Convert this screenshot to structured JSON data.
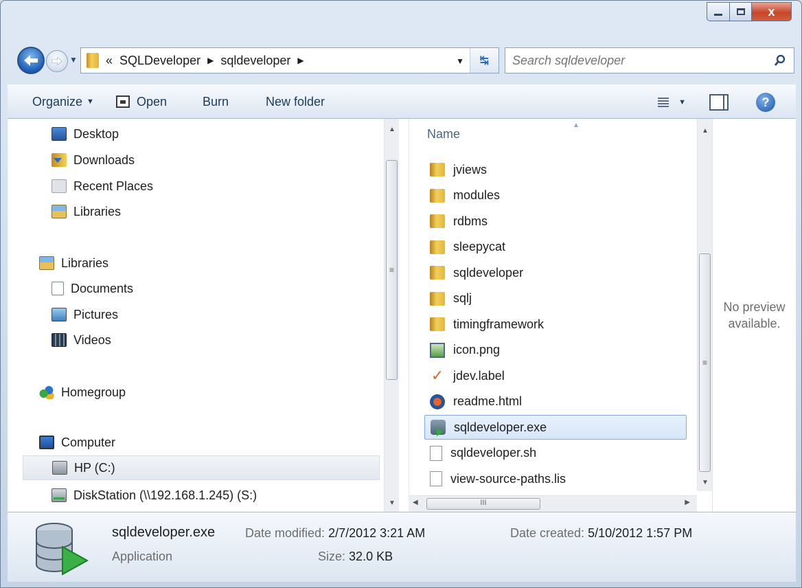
{
  "window": {
    "caption_buttons": {
      "minimize": "minimize",
      "maximize": "maximize",
      "close": "x"
    }
  },
  "address": {
    "overflow": "«",
    "crumbs": [
      "SQLDeveloper",
      "sqldeveloper"
    ],
    "search_placeholder": "Search sqldeveloper"
  },
  "toolbar": {
    "organize": "Organize",
    "open": "Open",
    "burn": "Burn",
    "new_folder": "New folder"
  },
  "nav": {
    "favorites": [
      "Desktop",
      "Downloads",
      "Recent Places",
      "Libraries"
    ],
    "libraries_root": "Libraries",
    "libraries": [
      "Documents",
      "Pictures",
      "Videos"
    ],
    "homegroup": "Homegroup",
    "computer": "Computer",
    "drives": [
      "HP (C:)",
      "DiskStation (\\\\192.168.1.245) (S:)"
    ]
  },
  "files": {
    "column_name": "Name",
    "items": [
      {
        "name": "jviews",
        "type": "folder"
      },
      {
        "name": "modules",
        "type": "folder"
      },
      {
        "name": "rdbms",
        "type": "folder"
      },
      {
        "name": "sleepycat",
        "type": "folder"
      },
      {
        "name": "sqldeveloper",
        "type": "folder"
      },
      {
        "name": "sqlj",
        "type": "folder"
      },
      {
        "name": "timingframework",
        "type": "folder"
      },
      {
        "name": "icon.png",
        "type": "png"
      },
      {
        "name": "jdev.label",
        "type": "label"
      },
      {
        "name": "readme.html",
        "type": "html"
      },
      {
        "name": "sqldeveloper.exe",
        "type": "exe",
        "selected": true
      },
      {
        "name": "sqldeveloper.sh",
        "type": "doc"
      },
      {
        "name": "view-source-paths.lis",
        "type": "doc"
      }
    ]
  },
  "preview": {
    "line1": "No preview",
    "line2": "available."
  },
  "details": {
    "name": "sqldeveloper.exe",
    "type": "Application",
    "modified_label": "Date modified:",
    "modified_value": "2/7/2012 3:21 AM",
    "size_label": "Size:",
    "size_value": "32.0 KB",
    "created_label": "Date created:",
    "created_value": "5/10/2012 1:57 PM"
  },
  "colors": {
    "selection": "#d6e6fa",
    "selection_border": "#84acdd",
    "accent": "#1e395b"
  }
}
